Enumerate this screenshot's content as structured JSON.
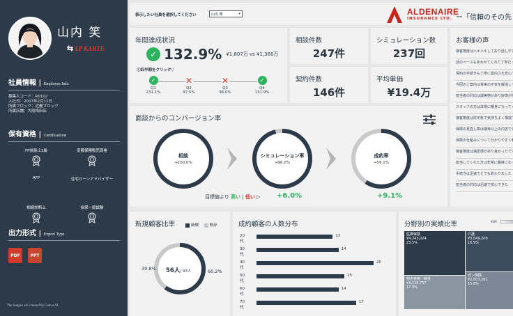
{
  "profile": {
    "name": "山内 笑",
    "karte_label": "LP KARTE",
    "karte_icon": "swap-icon"
  },
  "employee_info": {
    "title": "社員情報",
    "subtitle": "Employee Info",
    "lines": [
      "募集人コード：R0102",
      "入社日：2007年2月11日",
      "所属ブロック：近畿ブロック",
      "所属店舗：大阪梅田店"
    ]
  },
  "qualifications": {
    "title": "保有資格",
    "subtitle": "Certifications",
    "items": [
      "FP技能士2級",
      "変額保険販売資格",
      "AFP",
      "住宅ローンアドバイザー",
      "相続診断士",
      "損保一般試験"
    ]
  },
  "export": {
    "title": "出力形式",
    "subtitle": "Export Type",
    "items": [
      "PDF",
      "PPT"
    ]
  },
  "credit": "The images are created by Canva AI.",
  "topbar": {
    "selector_label": "表示したい社員を選択してください",
    "selected_employee": "山内 笑",
    "brand": "ALDENAIRE",
    "brand_sub": "INSURANCE LTD.",
    "slogan": "ー「信頼のその先"
  },
  "annual": {
    "title": "年間達成状況",
    "rate": "132.9%",
    "amounts": "¥1,807万 vs ¥1,360万",
    "hint": "Ⓘ四半期をクリック▽",
    "quarters": [
      {
        "label": "Q1",
        "value": "231.1%",
        "status": "ok"
      },
      {
        "label": "Q2",
        "value": "97.5%",
        "status": "ng"
      },
      {
        "label": "Q3",
        "value": "96.0%",
        "status": "ng"
      },
      {
        "label": "Q4",
        "value": "131.9%",
        "status": "ok"
      }
    ]
  },
  "kpis": {
    "consult": {
      "label": "相談件数",
      "value": "247件"
    },
    "simulation": {
      "label": "シミュレーション数",
      "value": "237回"
    },
    "contracts": {
      "label": "契約件数",
      "value": "146件"
    },
    "avg_price": {
      "label": "平均単価",
      "value": "¥19.4万"
    }
  },
  "voice": {
    "title": "お客様の声",
    "items": [
      "接客態度はハキハキしており話しやすかった",
      "話のペースもあわせてくれて丁寧だった",
      "契約の手続きも丁寧に案内され安心でした",
      "今回のご案内は将来の不安を解消してくれた",
      "担当者の対応は誠実感があり好感が持てた",
      "スタッフの方は非常に親身になってくれました。",
      "接客態度は好印象で気持ちよく相談できた",
      "保険の見直し案は期待以上の内容でした",
      "保険の仕組みについて分かりやすく教えてもらえました。",
      "接客態度は満足感があり良かったです",
      "担当してくれた方は非常に親身になって対応してくれました。",
      "手続きは迅速でとても助かりました",
      "担当者の対応は迅速で安心できた"
    ]
  },
  "conversion": {
    "title": "面談からのコンバージョン率",
    "rings": [
      {
        "label": "相談",
        "sub": "↪100.0%",
        "ratio": 1.0
      },
      {
        "label": "シミュレーション率",
        "sub": "↪96.0%",
        "ratio": 0.96
      },
      {
        "label": "成約率",
        "sub": "↪59.1%",
        "ratio": 0.591
      }
    ],
    "target_prefix": "目標値より",
    "high": "高い",
    "low": "低い",
    "deltas": [
      "+6.0%",
      "+9.1%"
    ],
    "filter_icon": "sliders-icon"
  },
  "new_customer": {
    "title": "新規顧客比率",
    "legend_new": "新規",
    "legend_existing": "既存",
    "center": "56人",
    "center_sub": "/ 93人",
    "left_pct": "39.8%",
    "right_pct": "60.2%",
    "new_ratio": 0.602
  },
  "age_dist": {
    "title": "成約顧客の人数分布",
    "chart_data": {
      "type": "bar",
      "categories": [
        "20代",
        "30代",
        "40代",
        "50代",
        "60代",
        "70代"
      ],
      "values": [
        13,
        14,
        20,
        15,
        14,
        17
      ],
      "xlim": [
        0,
        20
      ]
    }
  },
  "field_perf": {
    "title": "分野別の実績比率",
    "legend_min": "¥2M",
    "cells": [
      {
        "name": "医療保険",
        "amount": "¥4,243,024",
        "pct": "23.5%"
      },
      {
        "name": "介護",
        "amount": "¥3,049,209",
        "pct": "16.9%"
      },
      {
        "name": "ガン保険",
        "amount": "¥2,803,281",
        "pct": "15.8%"
      },
      {
        "name": "特定疾病一時金",
        "amount": "¥3,119,757",
        "pct": "17.3%"
      }
    ]
  },
  "colors": {
    "navy": "#2c3a4a",
    "green": "#2db35d",
    "red": "#d23a2c",
    "gray": "#c9c9c9"
  }
}
